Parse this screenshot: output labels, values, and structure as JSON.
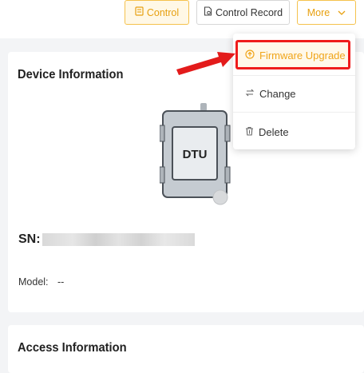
{
  "toolbar": {
    "control_label": "Control",
    "record_label": "Control Record",
    "more_label": "More"
  },
  "more_menu": {
    "items": [
      {
        "label": "Firmware Upgrade",
        "icon": "upload-circle-icon",
        "highlighted": true
      },
      {
        "label": "Change",
        "icon": "swap-icon"
      },
      {
        "label": "Delete",
        "icon": "trash-icon"
      }
    ]
  },
  "device": {
    "title": "Device Information",
    "image_text": "DTU",
    "sn_label": "SN: 4E",
    "model_label": "Model:",
    "model_value": "--"
  },
  "access": {
    "title": "Access Information"
  },
  "colors": {
    "accent": "#f5a623",
    "highlight_border": "#ef1c1c",
    "arrow": "#e31b1b"
  }
}
